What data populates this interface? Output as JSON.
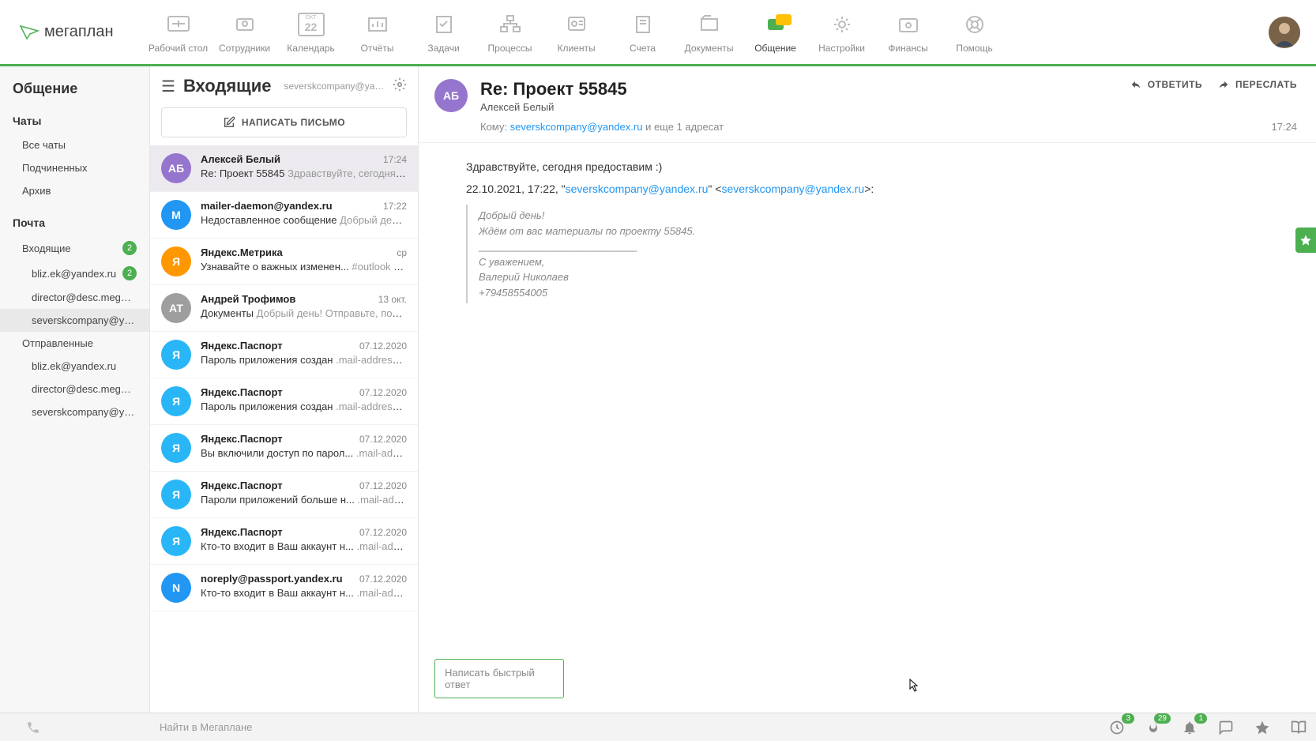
{
  "brand": "мегаплан",
  "nav": [
    {
      "label": "Рабочий стол",
      "icon": "desktop"
    },
    {
      "label": "Сотрудники",
      "icon": "employees"
    },
    {
      "label": "Календарь",
      "icon": "calendar",
      "badge": "ОКТ",
      "day": "22"
    },
    {
      "label": "Отчёты",
      "icon": "reports"
    },
    {
      "label": "Задачи",
      "icon": "tasks"
    },
    {
      "label": "Процессы",
      "icon": "processes"
    },
    {
      "label": "Клиенты",
      "icon": "clients"
    },
    {
      "label": "Счета",
      "icon": "invoices"
    },
    {
      "label": "Документы",
      "icon": "documents"
    },
    {
      "label": "Общение",
      "icon": "chat",
      "active": true
    },
    {
      "label": "Настройки",
      "icon": "settings"
    },
    {
      "label": "Финансы",
      "icon": "finance"
    },
    {
      "label": "Помощь",
      "icon": "help"
    }
  ],
  "side": {
    "title": "Общение",
    "chats": {
      "title": "Чаты",
      "items": [
        "Все чаты",
        "Подчиненных",
        "Архив"
      ]
    },
    "mail": {
      "title": "Почта",
      "inbox": {
        "label": "Входящие",
        "badge": "2",
        "accounts": [
          {
            "label": "bliz.ek@yandex.ru",
            "badge": "2"
          },
          {
            "label": "director@desc.megaplan.ru"
          },
          {
            "label": "severskcompany@yandex.ru",
            "active": true
          }
        ]
      },
      "sent": {
        "label": "Отправленные",
        "accounts": [
          {
            "label": "bliz.ek@yandex.ru"
          },
          {
            "label": "director@desc.megaplan.ru"
          },
          {
            "label": "severskcompany@yandex.ru"
          }
        ]
      }
    }
  },
  "list": {
    "title": "Входящие",
    "account": "severskcompany@yandex...",
    "compose": "НАПИСАТЬ ПИСЬМО",
    "items": [
      {
        "initials": "АБ",
        "color": "#9575cd",
        "sender": "Алексей Белый",
        "date": "17:24",
        "subject": "Re: Проект 55845",
        "preview": "Здравствуйте, сегодня пре...",
        "selected": true
      },
      {
        "initials": "M",
        "color": "#2196f3",
        "sender": "mailer-daemon@yandex.ru",
        "date": "17:22",
        "subject": "Недоставленное сообщение",
        "preview": "Добрый день! ..."
      },
      {
        "initials": "Я",
        "color": "#ff9800",
        "sender": "Яндекс.Метрика",
        "date": "ср",
        "subject": "Узнавайте о важных изменен...",
        "preview": "#outlook a {..."
      },
      {
        "initials": "АТ",
        "color": "#9e9e9e",
        "sender": "Андрей Трофимов",
        "date": "13 окт.",
        "subject": "Документы",
        "preview": "Добрый день! Отправьте, пожал..."
      },
      {
        "initials": "Я",
        "color": "#29b6f6",
        "sender": "Яндекс.Паспорт",
        "date": "07.12.2020",
        "subject": "Пароль приложения создан",
        "preview": ".mail-address a, ..."
      },
      {
        "initials": "Я",
        "color": "#29b6f6",
        "sender": "Яндекс.Паспорт",
        "date": "07.12.2020",
        "subject": "Пароль приложения создан",
        "preview": ".mail-address a, ..."
      },
      {
        "initials": "Я",
        "color": "#29b6f6",
        "sender": "Яндекс.Паспорт",
        "date": "07.12.2020",
        "subject": "Вы включили доступ по парол...",
        "preview": ".mail-addres..."
      },
      {
        "initials": "Я",
        "color": "#29b6f6",
        "sender": "Яндекс.Паспорт",
        "date": "07.12.2020",
        "subject": "Пароли приложений больше н...",
        "preview": ".mail-addres..."
      },
      {
        "initials": "Я",
        "color": "#29b6f6",
        "sender": "Яндекс.Паспорт",
        "date": "07.12.2020",
        "subject": "Кто-то входит в Ваш аккаунт н...",
        "preview": ".mail-addres..."
      },
      {
        "initials": "N",
        "color": "#2196f3",
        "sender": "noreply@passport.yandex.ru",
        "date": "07.12.2020",
        "subject": "Кто-то входит в Ваш аккаунт н...",
        "preview": ".mail-addres..."
      }
    ]
  },
  "reader": {
    "initials": "АБ",
    "title": "Re: Проект 55845",
    "from": "Алексей Белый",
    "to_label": "Кому:",
    "to_email": "severskcompany@yandex.ru",
    "to_rest": "и еще 1 адресат",
    "time": "17:24",
    "reply_btn": "ОТВЕТИТЬ",
    "forward_btn": "ПЕРЕСЛАТЬ",
    "body_line1": "Здравствуйте, сегодня предоставим :)",
    "body_line2_prefix": "22.10.2021, 17:22, \"",
    "body_line2_email": "severskcompany@yandex.ru",
    "body_line2_mid": "\" <",
    "body_line2_email2": "severskcompany@yandex.ru",
    "body_line2_suffix": ">:",
    "quote": {
      "l1": "Добрый день!",
      "l2": "Ждём от вас материалы по проекту 55845.",
      "l3": "________________________________",
      "l4": "С уважением,",
      "l5": "Валерий Николаев",
      "l6": "+79458554005"
    },
    "quick_reply": "Написать быстрый ответ"
  },
  "bottombar": {
    "search": "Найти в Мегаплане",
    "badges": {
      "clock": "3",
      "fire": "29",
      "bell": "1"
    }
  }
}
